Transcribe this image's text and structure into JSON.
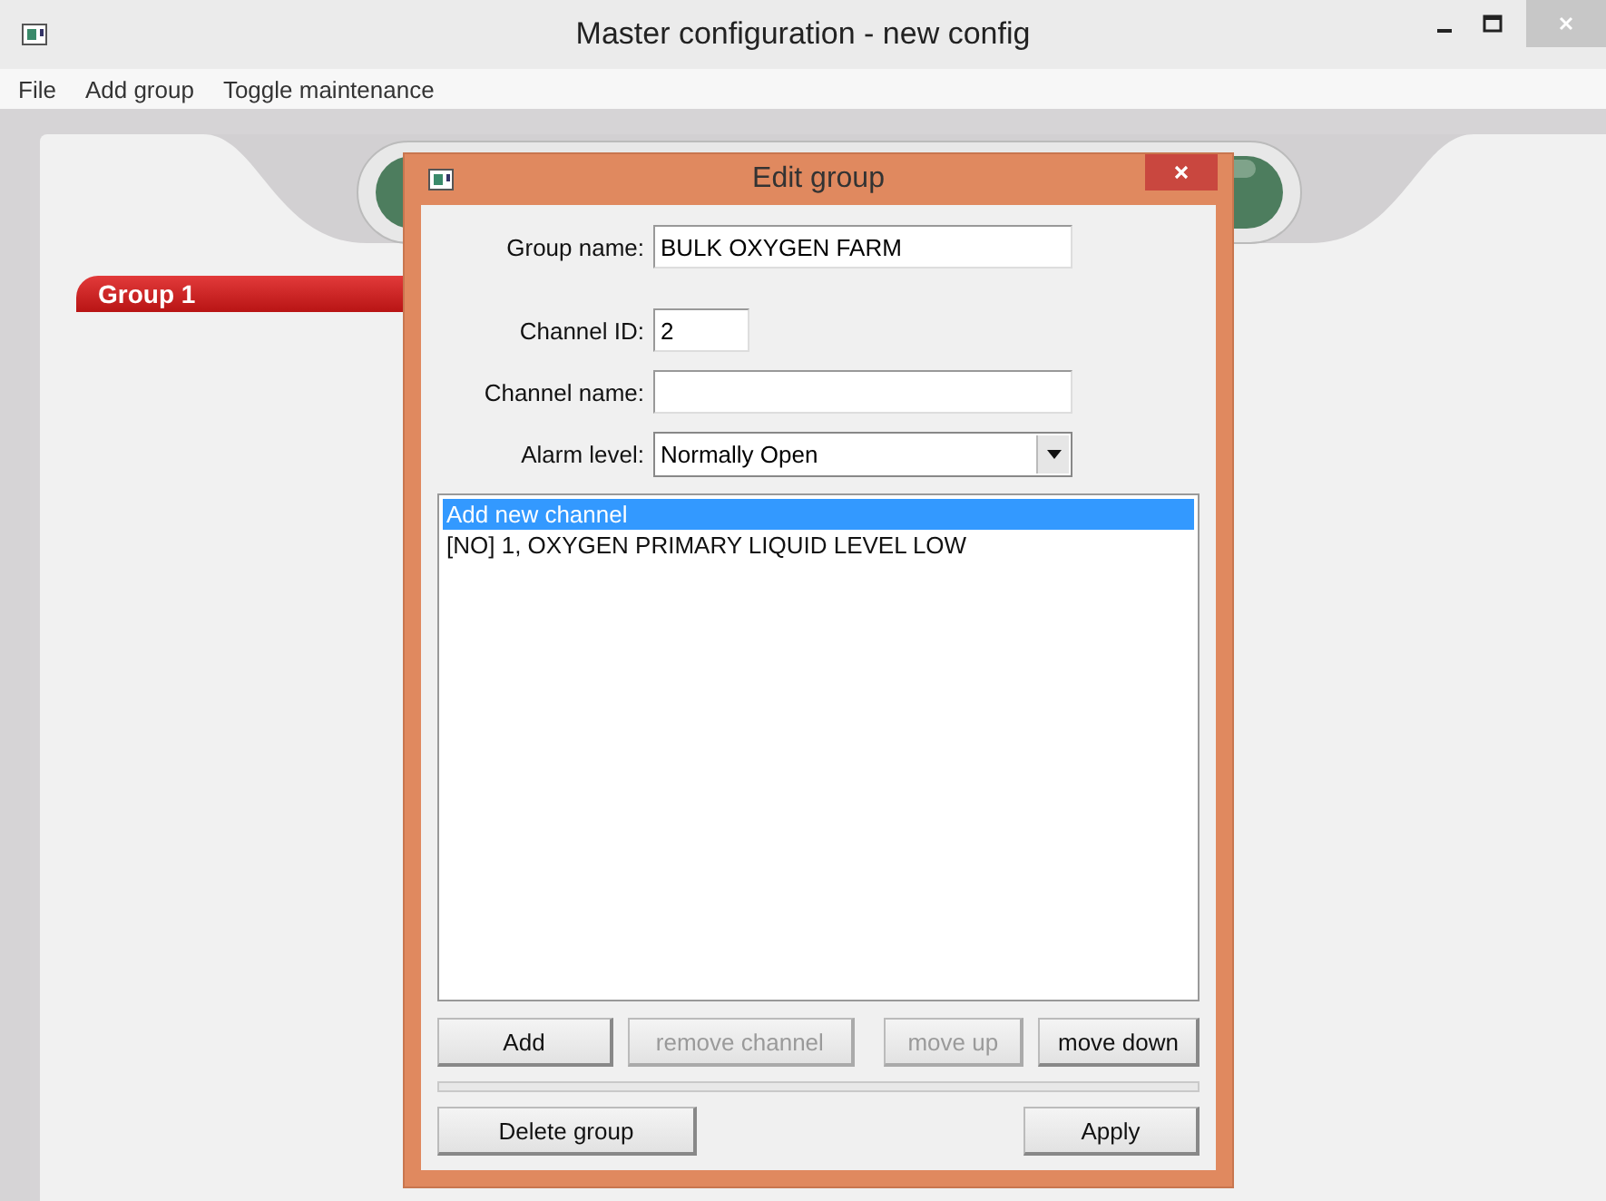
{
  "window": {
    "title": "Master configuration - new config"
  },
  "menu": [
    "File",
    "Add group",
    "Toggle maintenance"
  ],
  "groups": [
    {
      "label": "Group 1"
    }
  ],
  "dialog": {
    "title": "Edit group",
    "fields": [
      {
        "kind": "text",
        "label": "Group name:",
        "value": "BULK OXYGEN FARM"
      },
      {
        "kind": "text",
        "label": "Channel ID:",
        "value": "2"
      },
      {
        "kind": "text",
        "label": "Channel name:"
      },
      {
        "kind": "select",
        "label": "Alarm level:",
        "value": "Normally Open"
      }
    ],
    "channels": [
      {
        "label": "Add new channel",
        "selected": true
      },
      {
        "label": "[NO] 1, OXYGEN PRIMARY LIQUID LEVEL LOW",
        "selected": false
      }
    ],
    "list_buttons": [
      {
        "label": "Add",
        "disabled": false
      },
      {
        "label": "remove channel",
        "disabled": true
      },
      {
        "label": "move up",
        "disabled": true
      },
      {
        "label": "move down",
        "disabled": false
      }
    ],
    "footer_buttons": [
      {
        "label": "Delete group",
        "disabled": false
      },
      {
        "label": "Apply",
        "disabled": false
      }
    ]
  }
}
